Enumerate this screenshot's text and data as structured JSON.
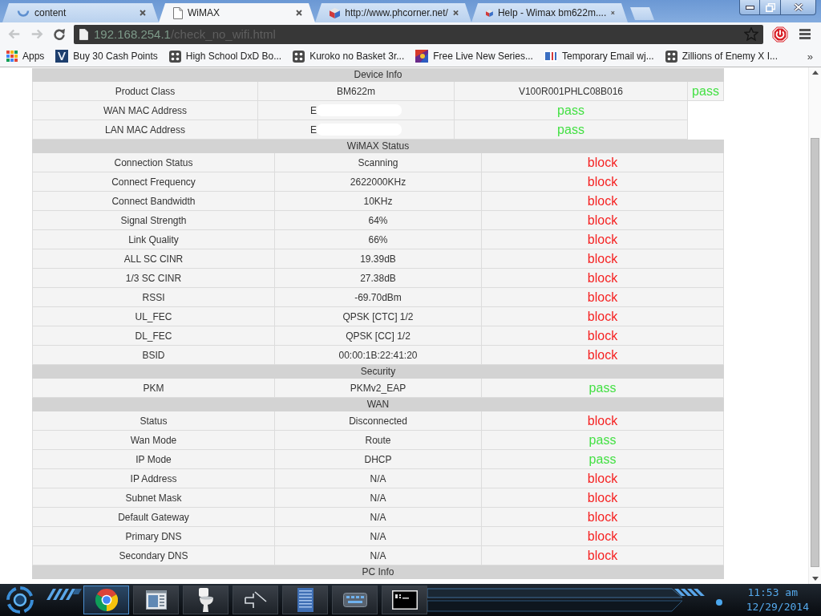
{
  "browser": {
    "tabs": [
      {
        "title": "content",
        "kind": "loading",
        "selected": false
      },
      {
        "title": "WiMAX",
        "kind": "page",
        "selected": true
      },
      {
        "title": "http://www.phcorner.net/",
        "kind": "site",
        "selected": false
      },
      {
        "title": "Help - Wimax bm622m....",
        "kind": "site",
        "selected": false
      }
    ],
    "nav": {
      "back_disabled": true,
      "forward_disabled": true
    },
    "address": {
      "host": "192.168.254.1",
      "path": "/check_no_wifi.html"
    },
    "bookmarks": [
      {
        "label": "Apps",
        "kind": "apps"
      },
      {
        "label": "Buy 30 Cash Points",
        "kind": "chevron-tile"
      },
      {
        "label": "High School DxD Bo...",
        "kind": "dots"
      },
      {
        "label": "Kuroko no Basket 3r...",
        "kind": "dots"
      },
      {
        "label": "Free Live New Series...",
        "kind": "picture-tile"
      },
      {
        "label": "Temporary Email wj...",
        "kind": "bars-logo"
      },
      {
        "label": "Zillions of Enemy X I...",
        "kind": "dots"
      }
    ],
    "bookmarks_overflow": "»"
  },
  "page": {
    "sections": [
      {
        "title": "Device Info",
        "rows": [
          {
            "cells": [
              "Product Class",
              "BM622m",
              "V100R001PHLC08B016"
            ],
            "redacted": false,
            "result": "pass",
            "color": "#44e044"
          },
          {
            "cells": [
              "WAN MAC Address",
              "E"
            ],
            "redacted": true,
            "result": "pass",
            "color": "#44e044"
          },
          {
            "cells": [
              "LAN MAC Address",
              "E"
            ],
            "redacted": true,
            "result": "pass",
            "color": "#44e044"
          }
        ]
      },
      {
        "title": "WiMAX Status",
        "rows": [
          {
            "cells": [
              "Connection Status",
              "Scanning"
            ],
            "result": "block",
            "color": "#f52222"
          },
          {
            "cells": [
              "Connect Frequency",
              "2622000KHz"
            ],
            "result": "block",
            "color": "#f52222"
          },
          {
            "cells": [
              "Connect Bandwidth",
              "10KHz"
            ],
            "result": "block",
            "color": "#f52222"
          },
          {
            "cells": [
              "Signal Strength",
              "64%"
            ],
            "result": "block",
            "color": "#f52222"
          },
          {
            "cells": [
              "Link Quality",
              "66%"
            ],
            "result": "block",
            "color": "#f52222"
          },
          {
            "cells": [
              "ALL SC CINR",
              "19.39dB"
            ],
            "result": "block",
            "color": "#f52222"
          },
          {
            "cells": [
              "1/3 SC CINR",
              "27.38dB"
            ],
            "result": "block",
            "color": "#f52222"
          },
          {
            "cells": [
              "RSSI",
              "-69.70dBm"
            ],
            "result": "block",
            "color": "#f52222"
          },
          {
            "cells": [
              "UL_FEC",
              "QPSK [CTC] 1/2"
            ],
            "result": "block",
            "color": "#f52222"
          },
          {
            "cells": [
              "DL_FEC",
              "QPSK [CC] 1/2"
            ],
            "result": "block",
            "color": "#f52222"
          },
          {
            "cells": [
              "BSID",
              "00:00:1B:22:41:20"
            ],
            "result": "block",
            "color": "#f52222"
          }
        ]
      },
      {
        "title": "Security",
        "rows": [
          {
            "cells": [
              "PKM",
              "PKMv2_EAP"
            ],
            "result": "pass",
            "color": "#44e044"
          }
        ]
      },
      {
        "title": "WAN",
        "rows": [
          {
            "cells": [
              "Status",
              "Disconnected"
            ],
            "result": "block",
            "color": "#f52222"
          },
          {
            "cells": [
              "Wan Mode",
              "Route"
            ],
            "result": "pass",
            "color": "#44e044"
          },
          {
            "cells": [
              "IP Mode",
              "DHCP"
            ],
            "result": "pass",
            "color": "#44e044"
          },
          {
            "cells": [
              "IP Address",
              "N/A"
            ],
            "result": "block",
            "color": "#f52222"
          },
          {
            "cells": [
              "Subnet Mask",
              "N/A"
            ],
            "result": "block",
            "color": "#f52222"
          },
          {
            "cells": [
              "Default Gateway",
              "N/A"
            ],
            "result": "block",
            "color": "#f52222"
          },
          {
            "cells": [
              "Primary DNS",
              "N/A"
            ],
            "result": "block",
            "color": "#f52222"
          },
          {
            "cells": [
              "Secondary DNS",
              "N/A"
            ],
            "result": "block",
            "color": "#f52222"
          }
        ]
      },
      {
        "title": "PC Info"
      }
    ]
  },
  "taskbar": {
    "apps": [
      {
        "kind": "browser",
        "selected": true
      },
      {
        "kind": "window",
        "selected": false
      },
      {
        "kind": "toilet",
        "selected": false
      },
      {
        "kind": "arrow",
        "selected": false
      },
      {
        "kind": "server",
        "selected": false
      },
      {
        "kind": "keyboard",
        "selected": false
      },
      {
        "kind": "terminal",
        "selected": false
      }
    ],
    "time": "11:53 am",
    "date": "12/29/2014"
  }
}
